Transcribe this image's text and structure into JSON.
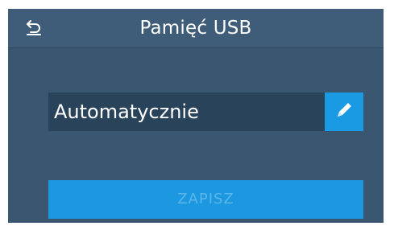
{
  "header": {
    "title": "Pamięć USB",
    "back_icon": "back-arrow-icon"
  },
  "form": {
    "field_value": "Automatycznie",
    "edit_icon": "pencil-icon"
  },
  "actions": {
    "save_label": "ZAPISZ",
    "save_enabled": false
  },
  "colors": {
    "background": "#3a5670",
    "header": "#3f5d78",
    "field": "#28435a",
    "accent": "#1a9ae3",
    "disabled_text": "#5cb6ea"
  }
}
